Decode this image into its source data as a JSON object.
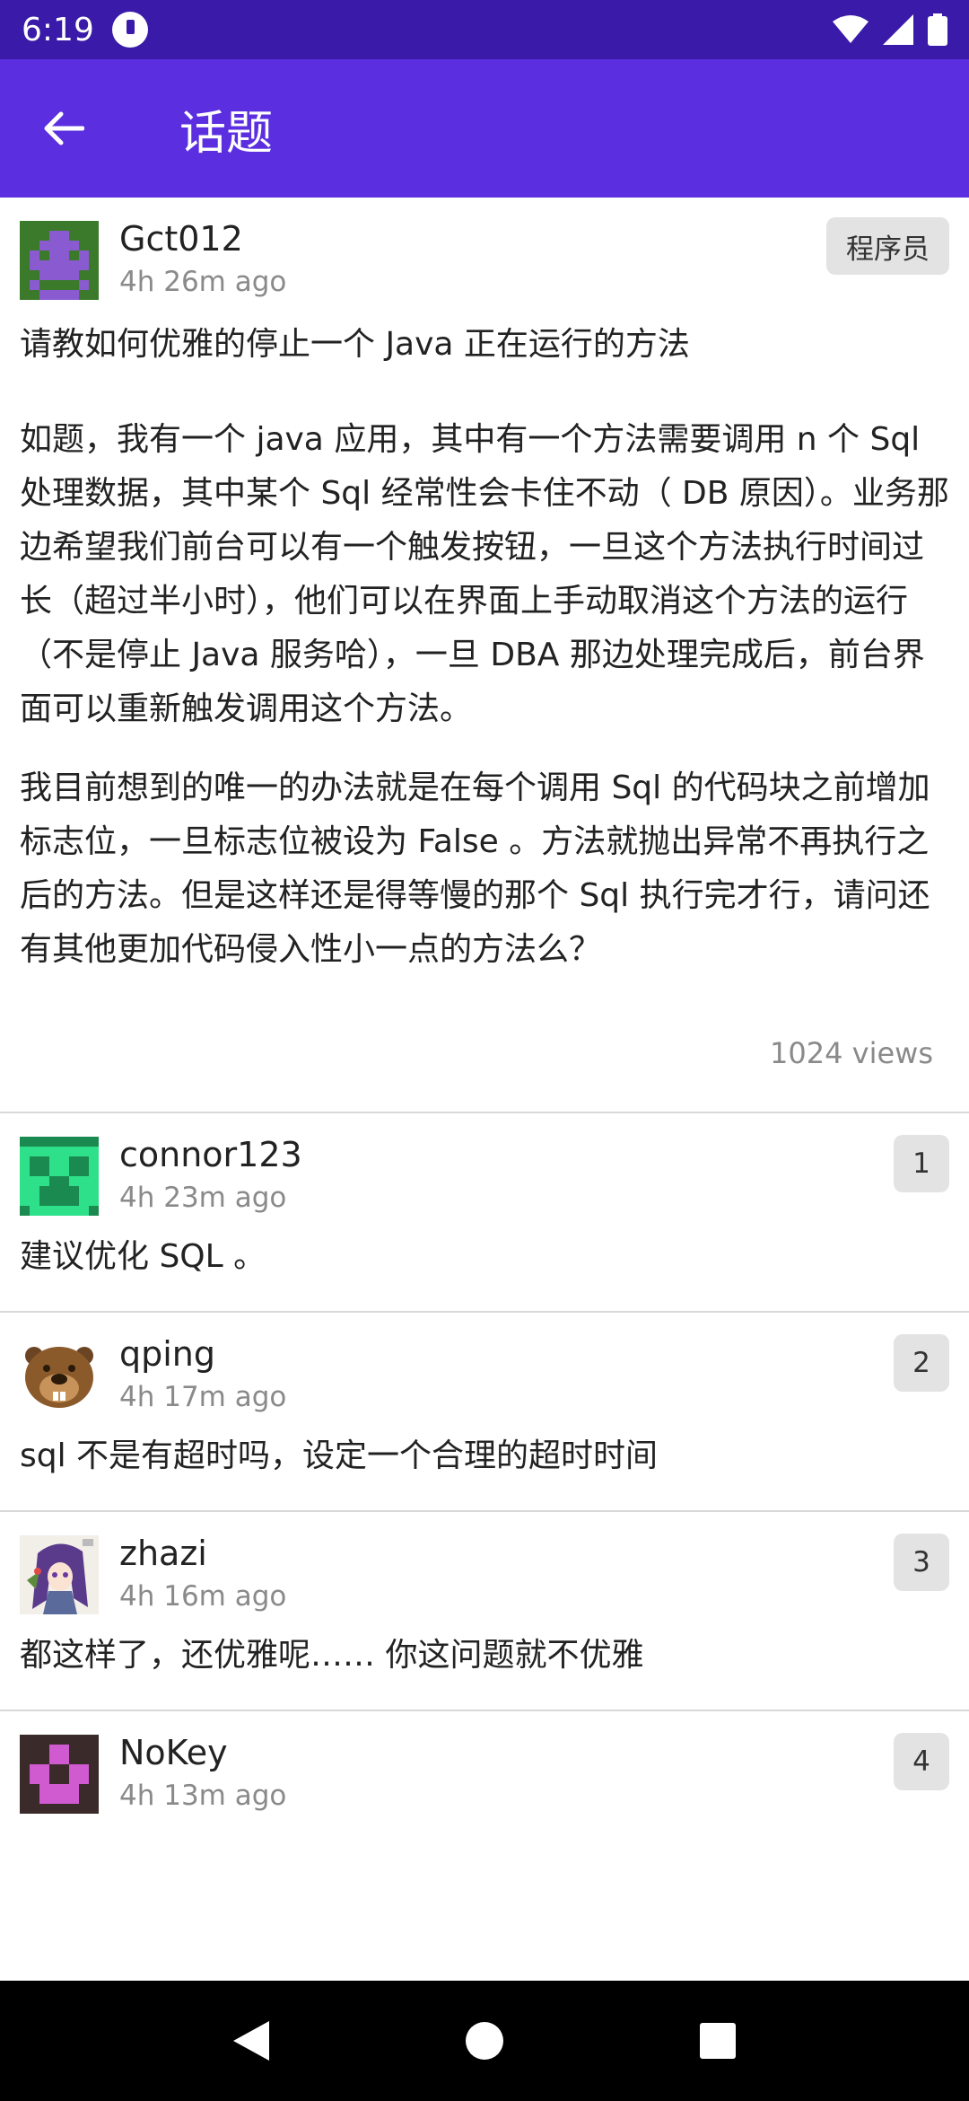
{
  "status_bar": {
    "time": "6:19"
  },
  "app_bar": {
    "title": "话题",
    "back_icon": "arrow-left-icon"
  },
  "topic": {
    "username": "Gct012",
    "time": "4h 26m ago",
    "node": "程序员",
    "title": "请教如何优雅的停止一个 Java 正在运行的方法",
    "paragraphs": [
      "如题，我有一个 java 应用，其中有一个方法需要调用 n 个 Sql 处理数据，其中某个 Sql 经常性会卡住不动（ DB 原因）。业务那边希望我们前台可以有一个触发按钮，一旦这个方法执行时间过长（超过半小时），他们可以在界面上手动取消这个方法的运行（不是停止 Java 服务哈），一旦 DBA 那边处理完成后，前台界面可以重新触发调用这个方法。",
      "我目前想到的唯一的办法就是在每个调用 Sql 的代码块之前增加标志位，一旦标志位被设为 False 。方法就抛出异常不再执行之后的方法。但是这样还是得等慢的那个 Sql 执行完才行，请问还有其他更加代码侵入性小一点的方法么？"
    ],
    "views": "1024 views"
  },
  "replies": [
    {
      "username": "connor123",
      "time": "4h 23m ago",
      "floor": "1",
      "body": "建议优化 SQL 。"
    },
    {
      "username": "qping",
      "time": "4h 17m ago",
      "floor": "2",
      "body": "sql 不是有超时吗，设定一个合理的超时时间"
    },
    {
      "username": "zhazi",
      "time": "4h 16m ago",
      "floor": "3",
      "body": "都这样了，还优雅呢…… 你这问题就不优雅"
    },
    {
      "username": "NoKey",
      "time": "4h 13m ago",
      "floor": "4",
      "body": ""
    }
  ],
  "colors": {
    "status_bar": "#3a1aa8",
    "app_bar": "#5b2fe0",
    "badge_bg": "#e3e3e3",
    "secondary_text": "#8a8a8a"
  }
}
